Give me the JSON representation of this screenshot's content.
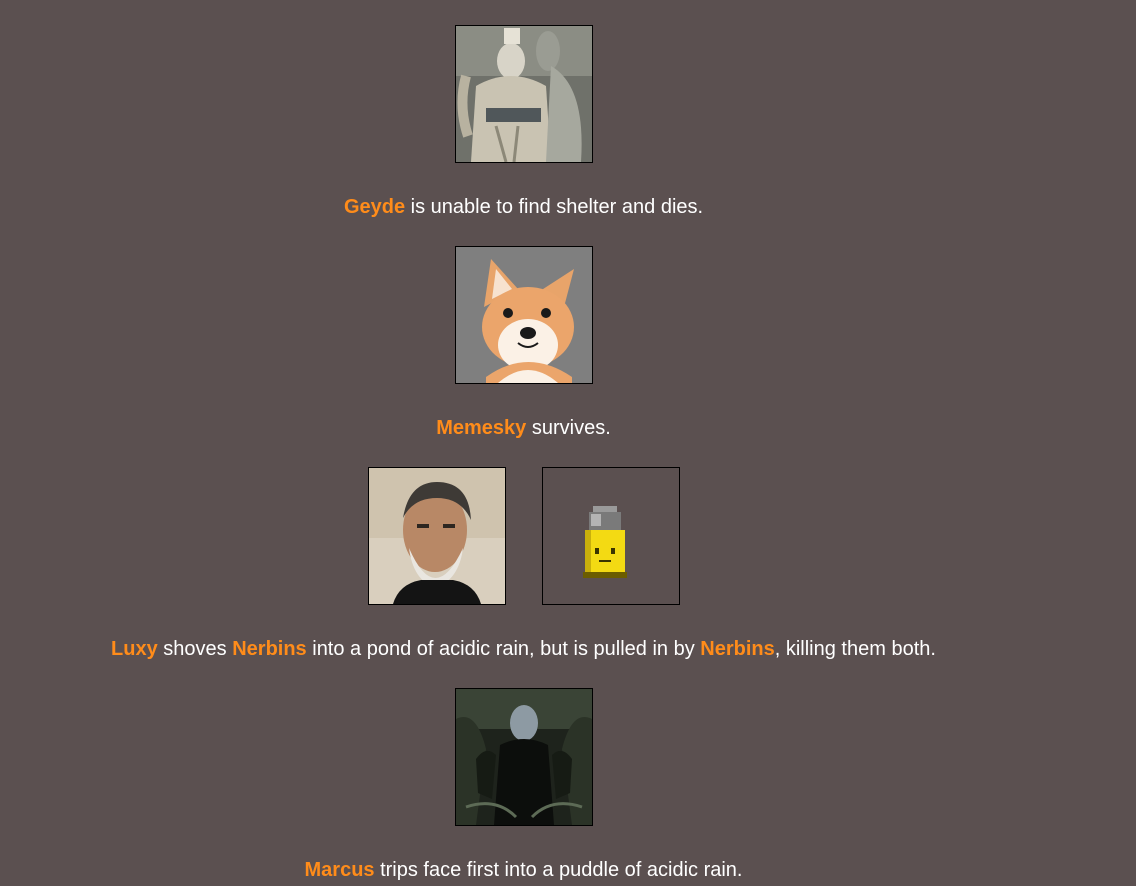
{
  "events": [
    {
      "avatars": [
        "stand-warrior-icon"
      ],
      "parts": [
        {
          "text": "Geyde",
          "name": true
        },
        {
          "text": " is unable to find shelter and dies.",
          "name": false
        }
      ]
    },
    {
      "avatars": [
        "shiba-dog-icon"
      ],
      "parts": [
        {
          "text": "Memesky",
          "name": true
        },
        {
          "text": " survives.",
          "name": false
        }
      ]
    },
    {
      "avatars": [
        "bearded-man-icon",
        "bullet-icon"
      ],
      "parts": [
        {
          "text": "Luxy",
          "name": true
        },
        {
          "text": " shoves ",
          "name": false
        },
        {
          "text": "Nerbins",
          "name": true
        },
        {
          "text": " into a pond of acidic rain, but is pulled in by ",
          "name": false
        },
        {
          "text": "Nerbins",
          "name": true
        },
        {
          "text": ", killing them both.",
          "name": false
        }
      ]
    },
    {
      "avatars": [
        "dark-horseman-icon"
      ],
      "parts": [
        {
          "text": "Marcus",
          "name": true
        },
        {
          "text": " trips face first into a puddle of acidic rain.",
          "name": false
        }
      ]
    }
  ],
  "colors": {
    "background": "#5b5050",
    "tribute_name": "#ff8c1a",
    "text": "#ffffff"
  }
}
